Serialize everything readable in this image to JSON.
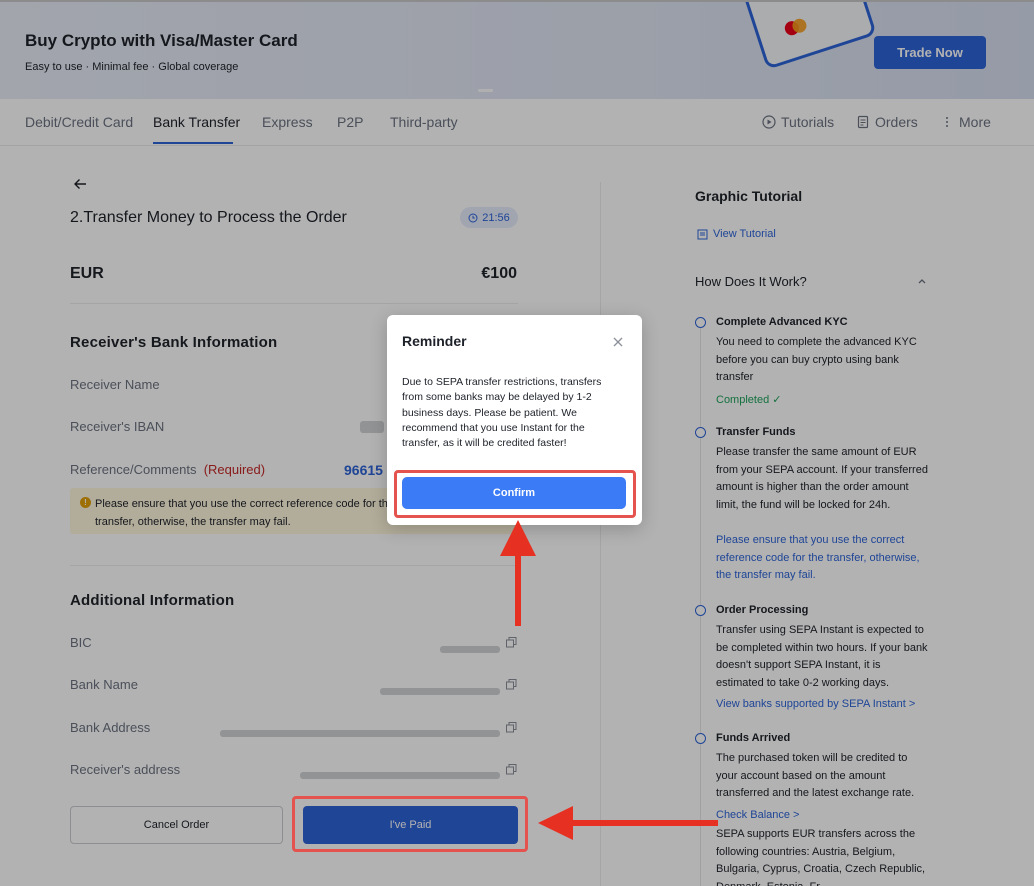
{
  "banner": {
    "title": "Buy Crypto with Visa/Master Card",
    "subtitle": "Easy to use · Minimal fee · Global coverage",
    "trade_label": "Trade Now"
  },
  "tabs": [
    "Debit/Credit Card",
    "Bank Transfer",
    "Express",
    "P2P",
    "Third-party"
  ],
  "active_tab": "Bank Transfer",
  "tools": {
    "tutorials": "Tutorials",
    "orders": "Orders",
    "more": "More"
  },
  "order": {
    "step_title": "2.Transfer Money to Process the Order",
    "timer": "21:56",
    "currency": "EUR",
    "amount": "€100"
  },
  "receiver": {
    "section_title": "Receiver's Bank Information",
    "name_label": "Receiver Name",
    "iban_label": "Receiver's IBAN",
    "reference_label": "Reference/Comments",
    "required_tag": "(Required)",
    "reference_value": "96615",
    "notice": "Please ensure that you use the correct reference code for the transfer, otherwise, the transfer may fail."
  },
  "additional": {
    "section_title": "Additional Information",
    "bic_label": "BIC",
    "bank_name_label": "Bank Name",
    "bank_address_label": "Bank Address",
    "receiver_address_label": "Receiver's address"
  },
  "actions": {
    "cancel_label": "Cancel Order",
    "paid_label": "I've Paid"
  },
  "tutorial": {
    "title": "Graphic Tutorial",
    "view_label": "View Tutorial",
    "how_title": "How Does It Work?",
    "steps": [
      {
        "title": "Complete Advanced KYC",
        "text": "You need to complete the advanced KYC before you can buy crypto using bank transfer",
        "status": "Completed ✓"
      },
      {
        "title": "Transfer Funds",
        "text": "Please transfer the same amount of EUR from your SEPA account. If your transferred amount is higher than the order amount limit, the fund will be locked for 24h.",
        "note": "Please ensure that you use the correct reference code for the transfer, otherwise, the transfer may fail."
      },
      {
        "title": "Order Processing",
        "text": "Transfer using SEPA Instant is expected to be completed within two hours. If your bank doesn't support SEPA Instant, it is estimated to take 0-2 working days.",
        "link": "View banks supported by SEPA Instant >"
      },
      {
        "title": "Funds Arrived",
        "text": "The purchased token will be credited to your account based on the amount transferred and the latest exchange rate.",
        "link": "Check Balance >",
        "extra": "SEPA supports EUR transfers across the following countries: Austria, Belgium, Bulgaria, Cyprus, Croatia, Czech Republic, Denmark, Estonia, Fr..."
      }
    ]
  },
  "modal": {
    "title": "Reminder",
    "body": "Due to SEPA transfer restrictions, transfers from some banks may be delayed by 1-2 business days. Please be patient. We recommend that you use Instant for the transfer, as it will be credited faster!",
    "confirm_label": "Confirm"
  },
  "colors": {
    "accent": "#2d64d8",
    "confirm": "#3b7bf6",
    "highlight": "#e4534d",
    "success": "#1ea35b",
    "required": "#c62828"
  }
}
